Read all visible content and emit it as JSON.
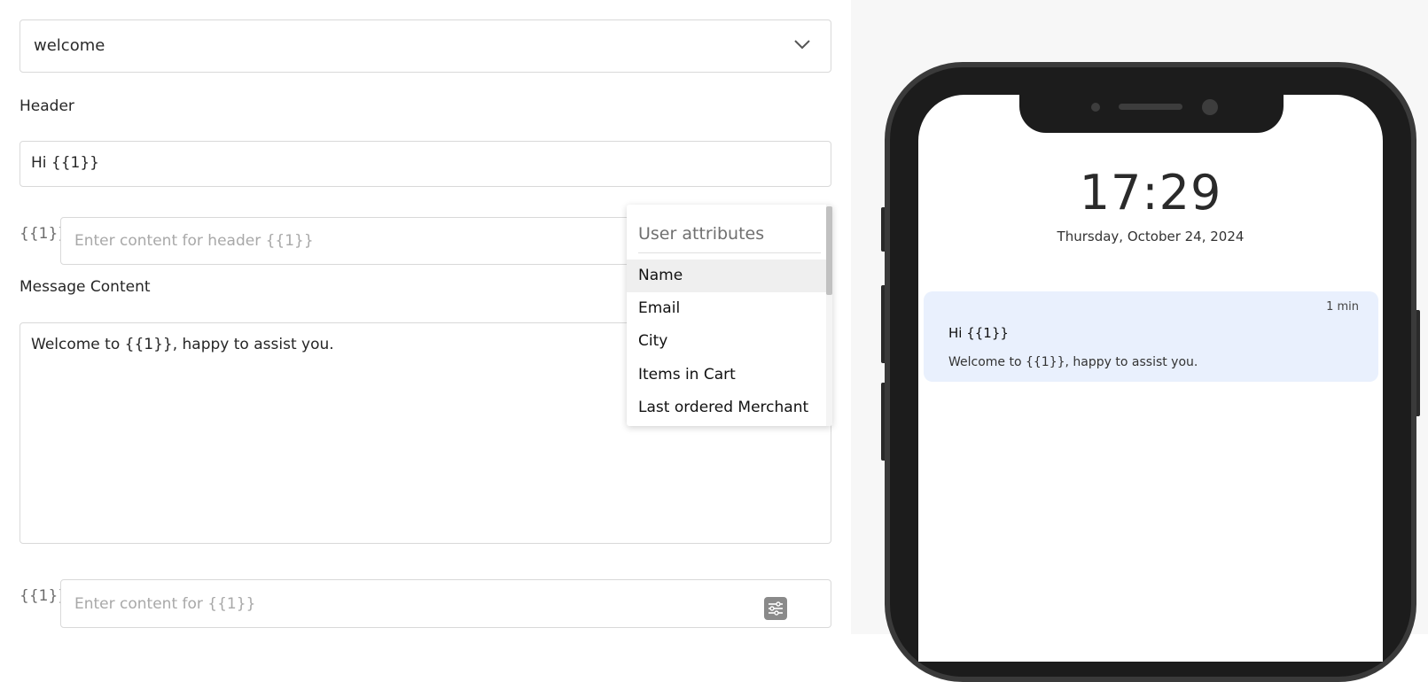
{
  "template_select": {
    "value": "welcome"
  },
  "header": {
    "label": "Header",
    "value": "Hi {{1}}",
    "variable": {
      "tag": "{{1}}",
      "placeholder": "Enter content for header {{1}}"
    }
  },
  "message": {
    "label": "Message Content",
    "value": "Welcome to {{1}}, happy to assist you.",
    "variable": {
      "tag": "{{1}}",
      "placeholder": "Enter content for {{1}}"
    }
  },
  "attributes_dropdown": {
    "title": "User attributes",
    "items": [
      {
        "label": "Name",
        "active": true
      },
      {
        "label": "Email"
      },
      {
        "label": "City"
      },
      {
        "label": "Items in Cart"
      },
      {
        "label": "Last ordered Merchant"
      }
    ]
  },
  "preview": {
    "time": "17:29",
    "date": "Thursday, October 24, 2024",
    "notification": {
      "age": "1 min",
      "title": "Hi {{1}}",
      "body": "Welcome to {{1}}, happy to assist you."
    }
  },
  "icons": {
    "select": "chevron-down-icon",
    "variable_picker": "sliders-icon"
  }
}
